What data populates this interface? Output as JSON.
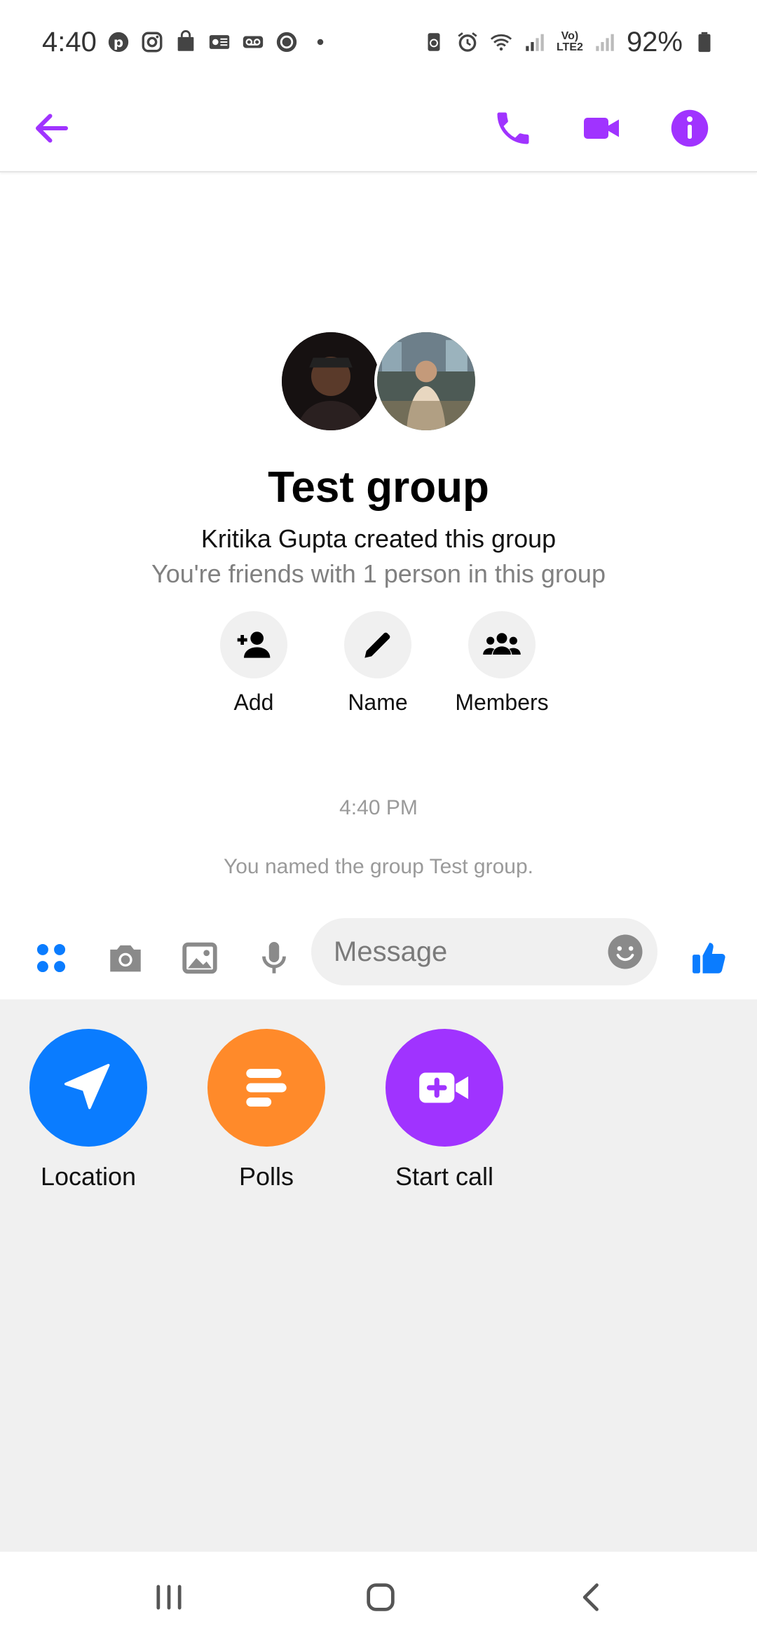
{
  "status_bar": {
    "time": "4:40",
    "battery": "92%",
    "network_label": "Vo) LTE2"
  },
  "header": {
    "back_icon": "arrow-left-icon",
    "call_icon": "phone-icon",
    "video_icon": "video-camera-icon",
    "info_icon": "info-icon",
    "accent": "#A033FF"
  },
  "chat": {
    "group_title": "Test group",
    "created_by": "Kritika Gupta created this group",
    "friends_note": "You're friends with 1 person in this group",
    "actions": [
      {
        "label": "Add",
        "icon": "add-person-icon"
      },
      {
        "label": "Name",
        "icon": "pencil-icon"
      },
      {
        "label": "Members",
        "icon": "group-icon"
      }
    ],
    "timestamp": "4:40 PM",
    "event_notice": "You named the group Test group."
  },
  "composer": {
    "placeholder": "Message",
    "value": "",
    "accent": "#0A7CFF"
  },
  "tray": {
    "items": [
      {
        "label": "Location",
        "icon": "navigation-arrow-icon",
        "color": "#0A7CFF"
      },
      {
        "label": "Polls",
        "icon": "poll-icon",
        "color": "#FF8A2A"
      },
      {
        "label": "Start call",
        "icon": "video-add-icon",
        "color": "#A033FF"
      }
    ]
  }
}
